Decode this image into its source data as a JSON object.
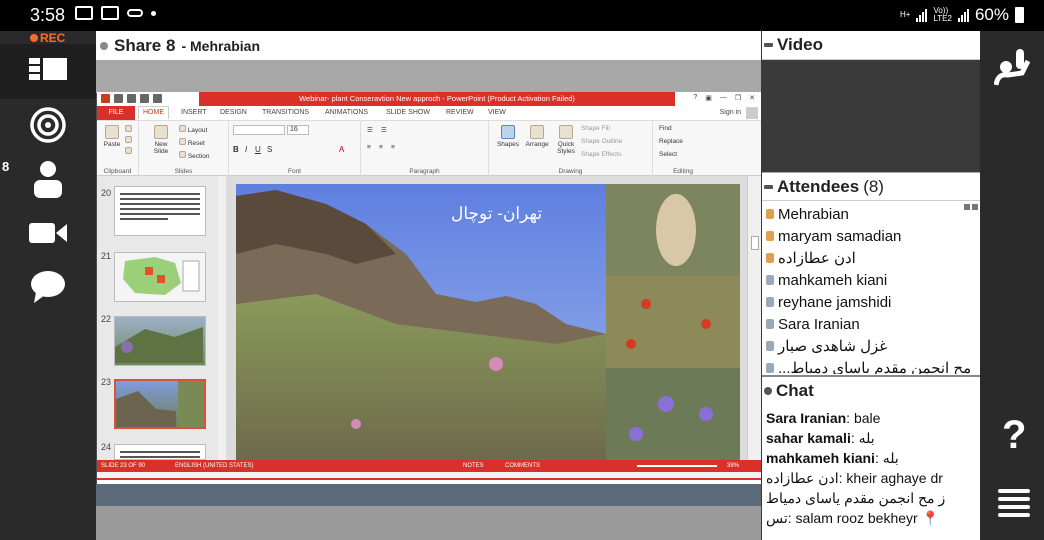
{
  "status_bar": {
    "time": "3:58",
    "net_a": "H+",
    "net_b": "LTE2",
    "net_c": "Vo))",
    "battery": "60%"
  },
  "left_bar": {
    "rec_label": "REC",
    "participants_badge": "8"
  },
  "share": {
    "title": "Share 8",
    "presenter": "- Mehrabian",
    "ppt": {
      "window_title": "Webinar- plant Conseravtion New approch - PowerPoint (Product Activation Failed)",
      "tabs": [
        "FILE",
        "HOME",
        "INSERT",
        "DESIGN",
        "TRANSITIONS",
        "ANIMATIONS",
        "SLIDE SHOW",
        "REVIEW",
        "VIEW"
      ],
      "sign_in": "Sign in",
      "ribbon": {
        "clipboard": {
          "label": "Clipboard",
          "paste": "Paste"
        },
        "slides": {
          "label": "Slides",
          "new_slide": "New Slide",
          "layout": "Layout",
          "reset": "Reset",
          "section": "Section"
        },
        "font": {
          "label": "Font",
          "size": "16"
        },
        "paragraph": {
          "label": "Paragraph"
        },
        "drawing": {
          "label": "Drawing",
          "shapes": "Shapes",
          "arrange": "Arrange",
          "quick_styles": "Quick Styles",
          "shape_fill": "Shape Fill",
          "shape_outline": "Shape Outline",
          "shape_effects": "Shape Effects"
        },
        "editing": {
          "label": "Editing",
          "find": "Find",
          "replace": "Replace",
          "select": "Select"
        }
      },
      "thumbnails": [
        {
          "num": "20"
        },
        {
          "num": "21"
        },
        {
          "num": "22"
        },
        {
          "num": "23"
        },
        {
          "num": "24"
        }
      ],
      "slide_title": "تهران- توچال",
      "status": {
        "slide": "SLIDE 23 OF 90",
        "language": "ENGLISH (UNITED STATES)",
        "notes": "NOTES",
        "comments": "COMMENTS",
        "zoom": "38%"
      }
    }
  },
  "video": {
    "title": "Video"
  },
  "attendees": {
    "title": "Attendees",
    "count": "(8)",
    "list": [
      {
        "name": "Mehrabian",
        "role": "host"
      },
      {
        "name": "maryam samadian",
        "role": "host"
      },
      {
        "name": "ادن عطازاده",
        "role": "host"
      },
      {
        "name": "mahkameh kiani",
        "role": "guest"
      },
      {
        "name": "reyhane jamshidi",
        "role": "guest"
      },
      {
        "name": "Sara Iranian",
        "role": "guest"
      },
      {
        "name": "غزل شاهدی صبار",
        "role": "guest"
      },
      {
        "name": "...مح انجمن مقدم یاسای دمیاط",
        "role": "guest"
      }
    ]
  },
  "chat": {
    "title": "Chat",
    "messages": [
      {
        "sender": "Sara Iranian",
        "text": "bale"
      },
      {
        "sender": "sahar kamali",
        "text": "بله"
      },
      {
        "sender": "mahkameh kiani",
        "text": "بله"
      },
      {
        "sender": "ادن عطازاده",
        "text": "kheir aghaye dr"
      },
      {
        "sender": "ز مح انجمن مقدم یاسای دمیاط",
        "text": ""
      },
      {
        "sender": "تس",
        "text": "salam rooz bekheyr"
      }
    ]
  },
  "colors": {
    "ppt_red": "#d9312a",
    "rec_orange": "#ff6a2a",
    "sidebar": "#2a2a2a"
  }
}
